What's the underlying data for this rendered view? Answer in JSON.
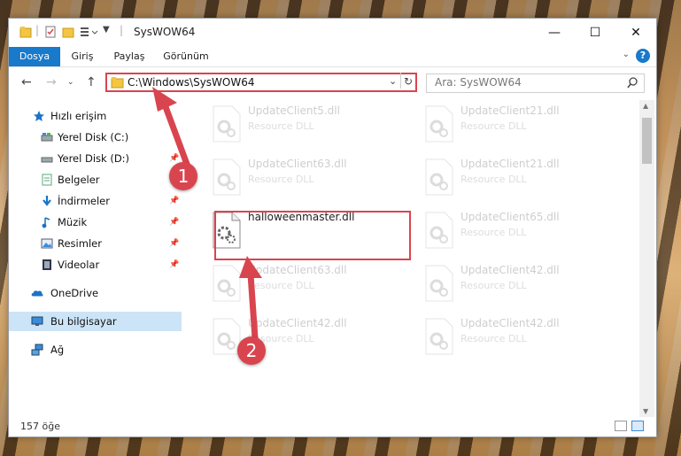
{
  "window": {
    "title": "SysWOW64",
    "controls": {
      "minimize": "—",
      "maximize": "☐",
      "close": "✕"
    }
  },
  "ribbon": {
    "tabs": [
      {
        "label": "Dosya",
        "active": true
      },
      {
        "label": "Giriş",
        "active": false
      },
      {
        "label": "Paylaş",
        "active": false
      },
      {
        "label": "Görünüm",
        "active": false
      }
    ],
    "help": "?"
  },
  "address": {
    "path": "C:\\Windows\\SysWOW64",
    "search_placeholder": "Ara: SysWOW64"
  },
  "sidebar": {
    "items": [
      {
        "label": "Hızlı erişim",
        "icon": "star-icon",
        "pinned": false
      },
      {
        "label": "Yerel Disk (C:)",
        "icon": "drive-icon",
        "pinned": false
      },
      {
        "label": "Yerel Disk (D:)",
        "icon": "drive-icon",
        "pinned": true
      },
      {
        "label": "Belgeler",
        "icon": "document-icon",
        "pinned": true
      },
      {
        "label": "İndirmeler",
        "icon": "download-icon",
        "pinned": true
      },
      {
        "label": "Müzik",
        "icon": "music-icon",
        "pinned": true
      },
      {
        "label": "Resimler",
        "icon": "pictures-icon",
        "pinned": true
      },
      {
        "label": "Videolar",
        "icon": "video-icon",
        "pinned": true
      },
      {
        "label": "OneDrive",
        "icon": "cloud-icon",
        "pinned": false
      },
      {
        "label": "Bu bilgisayar",
        "icon": "computer-icon",
        "pinned": false,
        "selected": true
      },
      {
        "label": "Ağ",
        "icon": "network-icon",
        "pinned": false
      }
    ]
  },
  "files": [
    {
      "name": "UpdateClient5.dll",
      "type": "Resource DLL",
      "faded": true
    },
    {
      "name": "UpdateClient21.dll",
      "type": "Resource DLL",
      "faded": true
    },
    {
      "name": "UpdateClient63.dll",
      "type": "Resource DLL",
      "faded": true
    },
    {
      "name": "UpdateClient21.dll",
      "type": "Resource DLL",
      "faded": true
    },
    {
      "name": "halloweenmaster.dll",
      "type": "",
      "faded": false
    },
    {
      "name": "UpdateClient65.dll",
      "type": "Resource DLL",
      "faded": true
    },
    {
      "name": "UpdateClient63.dll",
      "type": "Resource DLL",
      "faded": true
    },
    {
      "name": "UpdateClient42.dll",
      "type": "Resource DLL",
      "faded": true
    },
    {
      "name": "UpdateClient42.dll",
      "type": "Resource DLL",
      "faded": true
    },
    {
      "name": "UpdateClient42.dll",
      "type": "Resource DLL",
      "faded": true
    }
  ],
  "status": {
    "count": "157 öğe"
  },
  "annotations": {
    "step1": "1",
    "step2": "2"
  },
  "colors": {
    "accent": "#1979ca",
    "highlight": "#d9454f",
    "selection": "#cce4f7"
  }
}
